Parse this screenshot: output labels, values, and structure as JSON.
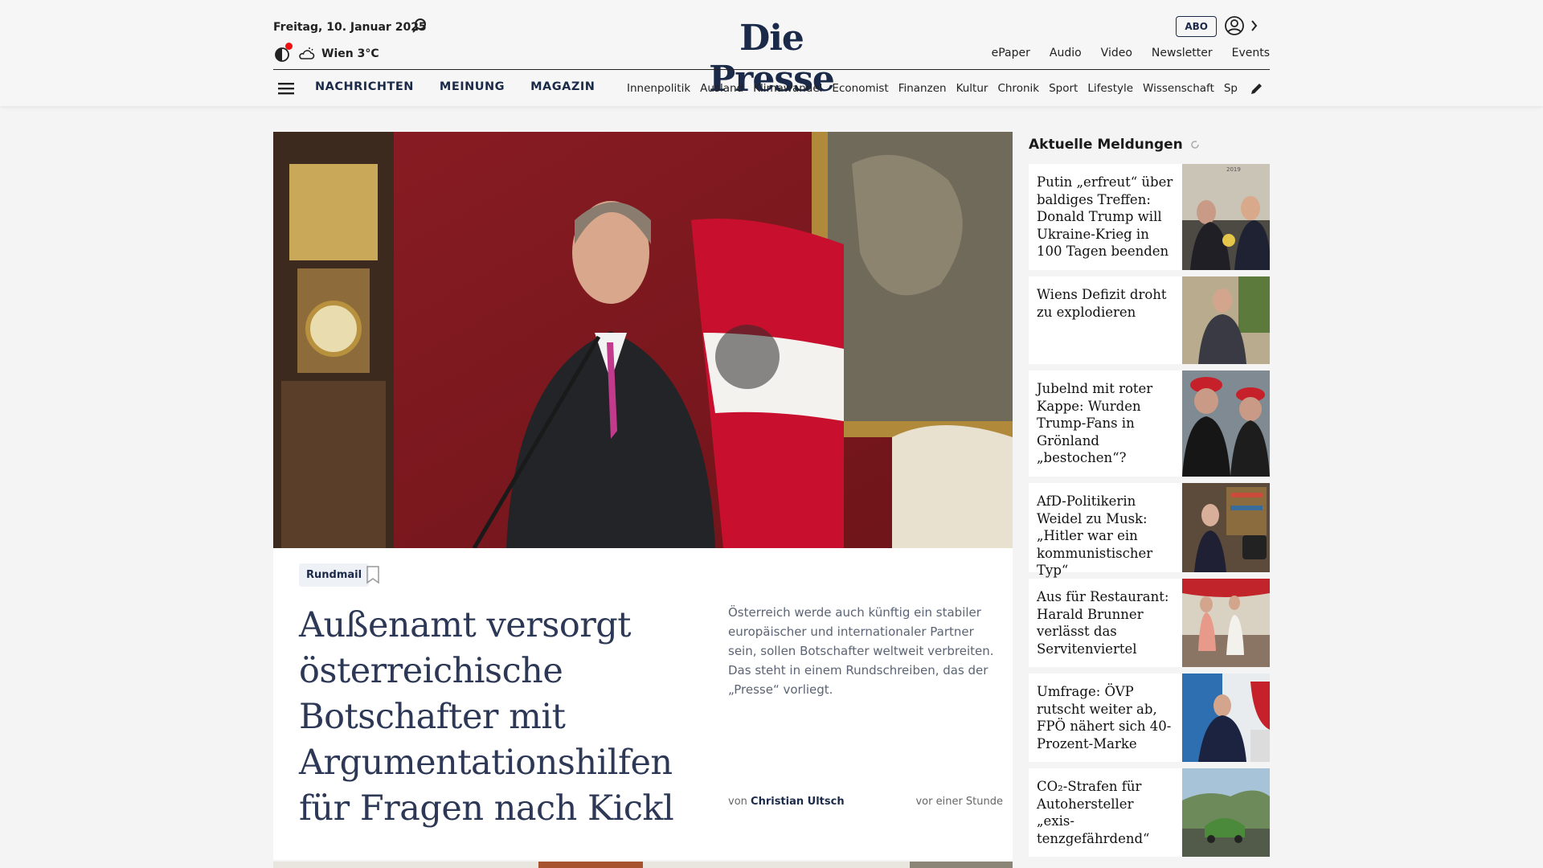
{
  "header": {
    "date": "Freitag, 10. Januar 2025",
    "weather": "Wien 3°C",
    "logo": "Die Presse",
    "abo_label": "ABO",
    "top_links": [
      "ePaper",
      "Audio",
      "Video",
      "Newsletter",
      "Events"
    ],
    "main_nav": [
      "NACHRICHTEN",
      "MEINUNG",
      "MAGAZIN"
    ],
    "sub_nav": [
      "Innenpolitik",
      "Ausland",
      "Klimawandel",
      "Economist",
      "Finanzen",
      "Kultur",
      "Chronik",
      "Sport",
      "Lifestyle",
      "Wissenschaft",
      "Spectrum"
    ]
  },
  "lead": {
    "tag": "Rundmail",
    "headline": "Außenamt versorgt österreichische Botschafter mit Argumentationshilfen für Fragen nach Kickl",
    "teaser": "Österreich werde auch künftig ein stabiler europäischer und internationaler Partner sein, sollen Botschafter weltweit verbreiten. Das steht in einem Rundschreiben, das der „Presse“ vorliegt.",
    "byline_prefix": "von",
    "author": "Christian Ultsch",
    "time": "vor einer Stunde"
  },
  "sidebar": {
    "title": "Aktuelle Meldungen",
    "items": [
      {
        "headline": "Putin „erfreut“ über baldiges Treffen: Donald Trump will Ukraine-Krieg in 100 Tagen beenden",
        "thumb_caption": "2019"
      },
      {
        "headline": "Wiens Defizit droht zu explodieren"
      },
      {
        "headline": "Jubelnd mit roter Kappe: Wurden Trump-Fans in Grönland „bestochen“?"
      },
      {
        "headline": "AfD-Politikerin Weidel zu Musk: „Hitler war ein kom­munistischer Typ“"
      },
      {
        "headline": "Aus für Restaurant: Harald Brunner verlässt das Servitenviertel"
      },
      {
        "headline": "Umfrage: ÖVP rutscht weiter ab, FPÖ nähert sich 40-Prozent-Marke"
      },
      {
        "headline": "CO₂-Strafen für Autohersteller „exis­tenzgefährdend“"
      }
    ]
  },
  "colors": {
    "brand_navy": "#1b2a48",
    "accent_red": "#c8102e",
    "teaser_gray": "#5b6474"
  }
}
